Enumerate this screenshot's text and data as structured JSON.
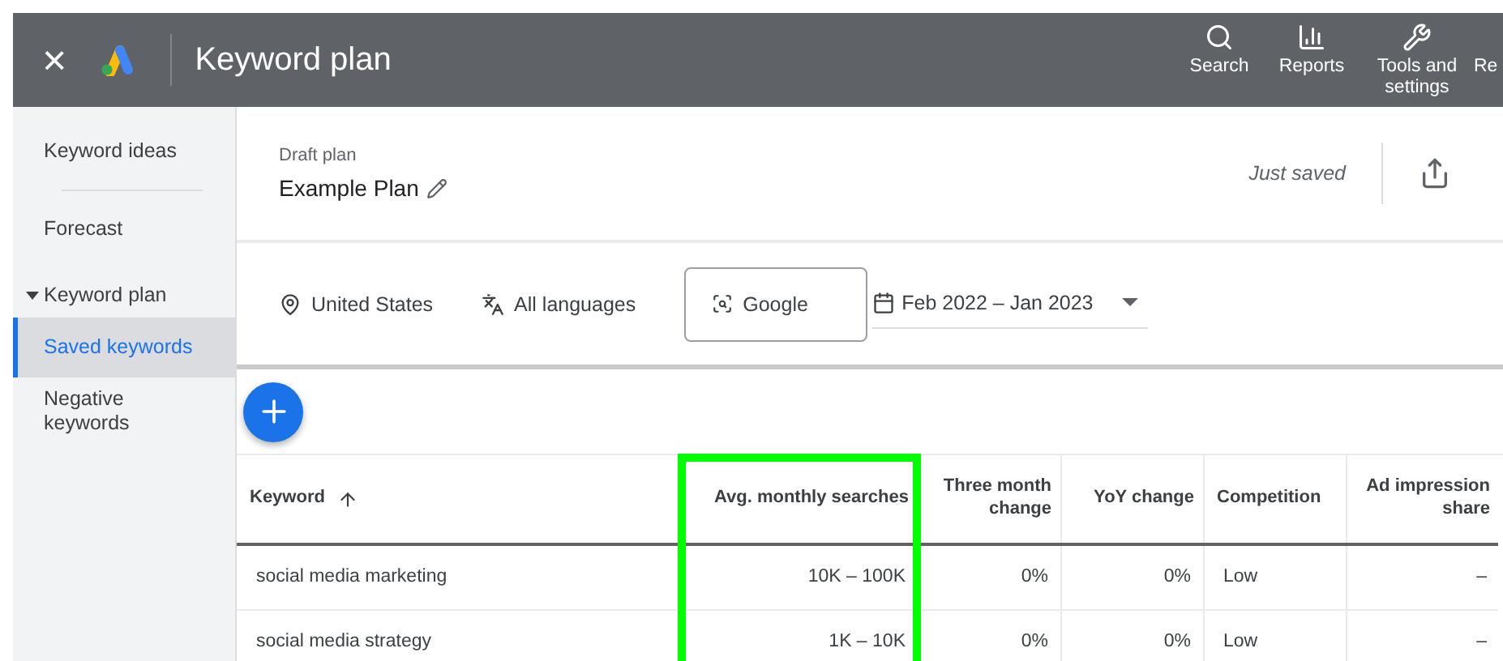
{
  "topbar": {
    "close": "×",
    "title": "Keyword plan",
    "nav": [
      {
        "label": "Search"
      },
      {
        "label": "Reports"
      },
      {
        "label": "Tools and settings"
      },
      {
        "label": "Re"
      }
    ]
  },
  "sidebar": {
    "items": [
      {
        "label": "Keyword ideas",
        "selected": false,
        "kind": "item"
      },
      {
        "label": "Forecast",
        "selected": false,
        "kind": "item"
      },
      {
        "label": "Keyword plan",
        "selected": false,
        "kind": "group",
        "expanded": true
      },
      {
        "label": "Saved keywords",
        "selected": true,
        "kind": "item"
      },
      {
        "label": "Negative keywords",
        "selected": false,
        "kind": "item"
      }
    ]
  },
  "plan": {
    "caption": "Draft plan",
    "name": "Example Plan",
    "status": "Just saved"
  },
  "filters": {
    "location": "United States",
    "language": "All languages",
    "network": "Google",
    "date_range": "Feb 2022 – Jan 2023"
  },
  "table": {
    "columns": [
      {
        "label": "Keyword",
        "sorted": true,
        "highlighted": false
      },
      {
        "label": "Avg. monthly searches",
        "sorted": false,
        "highlighted": true
      },
      {
        "label": "Three month change",
        "sorted": false,
        "highlighted": false
      },
      {
        "label": "YoY change",
        "sorted": false,
        "highlighted": false
      },
      {
        "label": "Competition",
        "sorted": false,
        "highlighted": false
      },
      {
        "label": "Ad impression share",
        "sorted": false,
        "highlighted": false
      }
    ],
    "rows": [
      [
        "social media marketing",
        "10K – 100K",
        "0%",
        "0%",
        "Low",
        "–"
      ],
      [
        "social media strategy",
        "1K – 10K",
        "0%",
        "0%",
        "Low",
        "–"
      ]
    ]
  }
}
